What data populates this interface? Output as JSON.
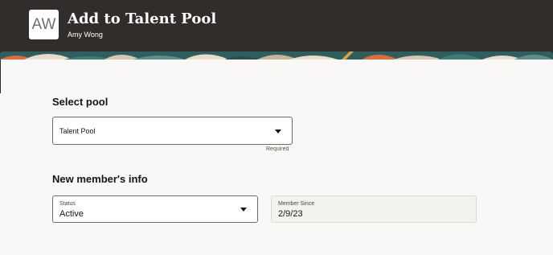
{
  "header": {
    "avatar_initials": "AW",
    "title": "Add to Talent Pool",
    "subtitle": "Amy Wong"
  },
  "colors": {
    "header_bg": "#312d2a",
    "content_bg": "#f9f8f6",
    "banner_teal": "#2e5f5f",
    "banner_orange": "#e06b3a",
    "banner_cream": "#e9dccb"
  },
  "select_pool": {
    "heading": "Select pool",
    "value": "Talent Pool",
    "helper": "Required",
    "icon": "chevron-down-icon"
  },
  "member_info": {
    "heading": "New member's info",
    "status": {
      "label": "Status",
      "value": "Active",
      "icon": "chevron-down-icon"
    },
    "member_since": {
      "label": "Member Since",
      "value": "2/9/23"
    }
  }
}
